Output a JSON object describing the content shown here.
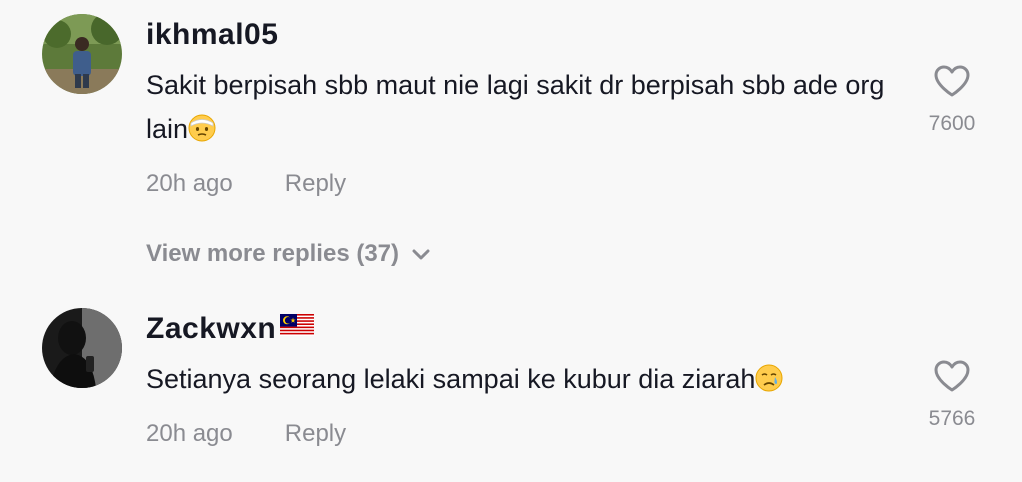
{
  "comments": [
    {
      "username": "ikhmal05",
      "text": "Sakit berpisah sbb maut nie lagi sakit dr berpisah sbb ade org lain",
      "emoji": "face-with-head-bandage-icon",
      "time": "20h ago",
      "reply_label": "Reply",
      "likes": "7600",
      "avatar": "user-avatar-outdoor"
    },
    {
      "username": "Zackwxn",
      "username_flag": "malaysia-flag-icon",
      "text": "Setianya seorang lelaki sampai ke kubur dia ziarah",
      "emoji": "crying-face-icon",
      "time": "20h ago",
      "reply_label": "Reply",
      "likes": "5766",
      "avatar": "user-avatar-dark-silhouette"
    }
  ],
  "view_more_replies": "View more replies (37)",
  "colors": {
    "background": "#f8f8f8",
    "primary_text": "#161823",
    "secondary_text": "#8a8b91"
  }
}
